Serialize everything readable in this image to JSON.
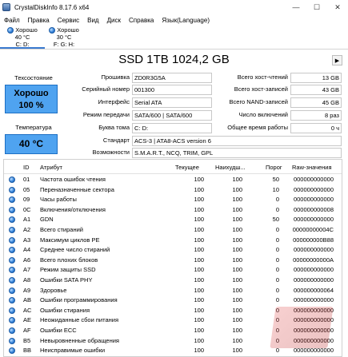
{
  "window": {
    "title": "CrystalDiskInfo 8.17.6 x64",
    "min": "—",
    "max": "☐",
    "close": "✕"
  },
  "menu": [
    "Файл",
    "Правка",
    "Сервис",
    "Вид",
    "Диск",
    "Справка",
    "Язык(Language)"
  ],
  "disks": [
    {
      "status": "Хорошо",
      "temp": "40 °C",
      "letters": "C: D:"
    },
    {
      "status": "Хорошо",
      "temp": "30 °C",
      "letters": "F: G: H:"
    }
  ],
  "drive": {
    "title": "SSD 1TB 1024,2 GB"
  },
  "health": {
    "label": "Техсостояние",
    "status": "Хорошо",
    "percent": "100 %",
    "color": "#4fa3f0"
  },
  "temperature": {
    "label": "Температура",
    "value": "40 °C"
  },
  "info_left": [
    {
      "label": "Прошивка",
      "value": "ZD0R3G5A"
    },
    {
      "label": "Серийный номер",
      "value": "001300"
    },
    {
      "label": "Интерфейс",
      "value": "Serial ATA"
    },
    {
      "label": "Режим передачи",
      "value": "SATA/600 | SATA/600"
    },
    {
      "label": "Буква тома",
      "value": "C: D:"
    }
  ],
  "info_right": [
    {
      "label": "Всего хост-чтений",
      "value": "13 GB"
    },
    {
      "label": "Всего хост-записей",
      "value": "43 GB"
    },
    {
      "label": "Всего NAND-записей",
      "value": "45 GB"
    },
    {
      "label": "Число включений",
      "value": "8 раз"
    },
    {
      "label": "Общее время работы",
      "value": "0 ч"
    }
  ],
  "standard": {
    "label": "Стандарт",
    "value": "ACS-3 | ATA8-ACS version 6"
  },
  "features": {
    "label": "Возможности",
    "value": "S.M.A.R.T., NCQ, TRIM, GPL"
  },
  "smart": {
    "headers": [
      "ID",
      "Атрибут",
      "Текущее",
      "Наихудш...",
      "Порог",
      "Raw-значения"
    ],
    "rows": [
      [
        "01",
        "Частота ошибок чтения",
        "100",
        "100",
        "50",
        "000000000000"
      ],
      [
        "05",
        "Переназначенные сектора",
        "100",
        "100",
        "10",
        "000000000000"
      ],
      [
        "09",
        "Часы работы",
        "100",
        "100",
        "0",
        "000000000000"
      ],
      [
        "0C",
        "Включения/отключения",
        "100",
        "100",
        "0",
        "000000000008"
      ],
      [
        "A1",
        "GDN",
        "100",
        "100",
        "50",
        "000000000000"
      ],
      [
        "A2",
        "Всего стираний",
        "100",
        "100",
        "0",
        "00000000004C"
      ],
      [
        "A3",
        "Максимум циклов PE",
        "100",
        "100",
        "0",
        "000000000B88"
      ],
      [
        "A4",
        "Среднее число стираний",
        "100",
        "100",
        "0",
        "000000000000"
      ],
      [
        "A6",
        "Всего плохих блоков",
        "100",
        "100",
        "0",
        "00000000000A"
      ],
      [
        "A7",
        "Режим защиты SSD",
        "100",
        "100",
        "0",
        "000000000000"
      ],
      [
        "A8",
        "Ошибки SATA PHY",
        "100",
        "100",
        "0",
        "000000000000"
      ],
      [
        "A9",
        "Здоровье",
        "100",
        "100",
        "0",
        "000000000064"
      ],
      [
        "AB",
        "Ошибки программирования",
        "100",
        "100",
        "0",
        "000000000000"
      ],
      [
        "AC",
        "Ошибки стирания",
        "100",
        "100",
        "0",
        "000000000000"
      ],
      [
        "AE",
        "Неожиданные сбои питания",
        "100",
        "100",
        "0",
        "000000000000"
      ],
      [
        "AF",
        "Ошибки ECC",
        "100",
        "100",
        "0",
        "000000000000"
      ],
      [
        "B5",
        "Невыровненные обращения",
        "100",
        "100",
        "0",
        "000000000000"
      ],
      [
        "BB",
        "Неисправимые ошибки",
        "100",
        "100",
        "0",
        "000000000000"
      ]
    ]
  }
}
